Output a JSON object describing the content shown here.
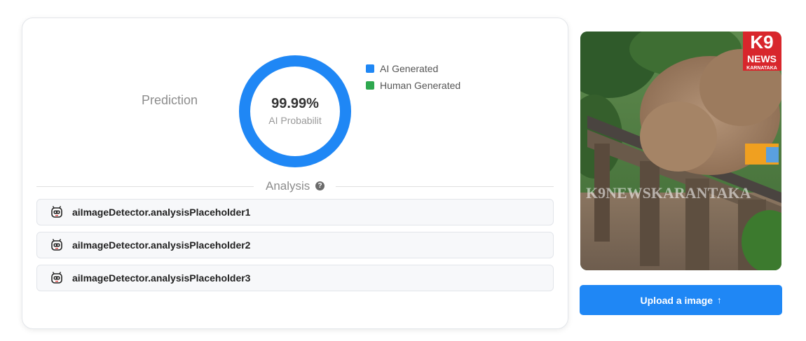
{
  "prediction": {
    "label": "Prediction",
    "value_text": "99.99%",
    "sub_text": "AI Probabilit",
    "ai_fraction": 0.9999
  },
  "legend": {
    "items": [
      {
        "label": "AI Generated",
        "color": "#1f87f5"
      },
      {
        "label": "Human Generated",
        "color": "#2ea84f"
      }
    ]
  },
  "analysis": {
    "title": "Analysis",
    "help_glyph": "?",
    "rows": [
      {
        "text": "aiImageDetector.analysisPlaceholder1",
        "icon": "robot-icon"
      },
      {
        "text": "aiImageDetector.analysisPlaceholder2",
        "icon": "robot-icon"
      },
      {
        "text": "aiImageDetector.analysisPlaceholder3",
        "icon": "robot-icon"
      }
    ]
  },
  "image_panel": {
    "logo_main": "K9",
    "logo_news": "NEWS",
    "logo_region": "KARNATAKA",
    "watermark": "K9NEWSKARANTAKA"
  },
  "upload": {
    "label": "Upload a image",
    "arrow": "↑"
  },
  "colors": {
    "accent": "#1f87f5",
    "human": "#2ea84f",
    "donut_track": "#e6e6e6"
  }
}
